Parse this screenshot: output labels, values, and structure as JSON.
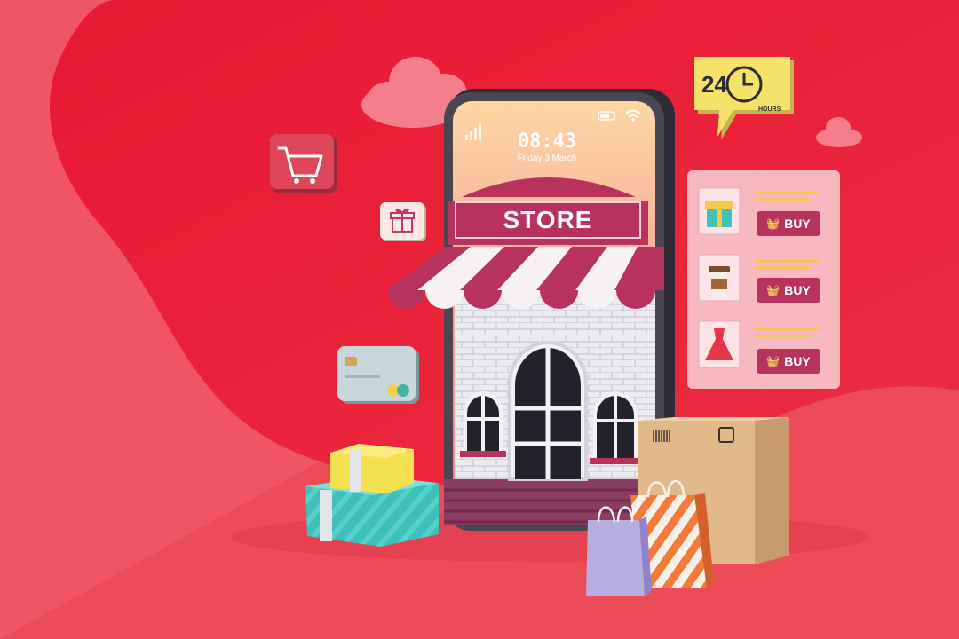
{
  "phone": {
    "time": "08:43",
    "date": "Friday 3 March"
  },
  "store": {
    "sign": "STORE"
  },
  "badge_24h": {
    "number": "24",
    "caption": "HOURS"
  },
  "shop_panel": {
    "items": [
      {
        "icon": "gift-box-icon",
        "button_label": "BUY"
      },
      {
        "icon": "coffee-cup-icon",
        "button_label": "BUY"
      },
      {
        "icon": "dress-icon",
        "button_label": "BUY"
      }
    ]
  },
  "colors": {
    "background": "#ec4b58",
    "accent": "#b8325e",
    "panel": "#f6c8cf",
    "badge": "#f5e26b"
  }
}
